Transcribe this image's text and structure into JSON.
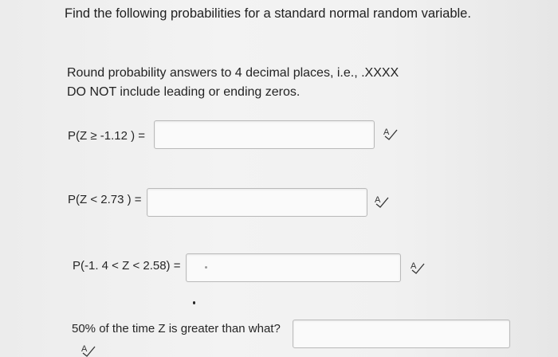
{
  "page": {
    "title": "Find the following probabilities for a standard normal random variable.",
    "instructions": [
      "Round probability answers to 4 decimal places, i.e., .XXXX",
      "DO NOT include leading or ending zeros."
    ]
  },
  "questions": [
    {
      "label": "P(Z ≥ -1.12 ) =",
      "value": ""
    },
    {
      "label": "P(Z < 2.73 ) =",
      "value": ""
    },
    {
      "label": "P(-1. 4 < Z < 2.58) =",
      "value": ""
    },
    {
      "label": "50% of the time Z is greater than what?",
      "value": ""
    }
  ],
  "icons": {
    "answer_check": "spell-check-icon"
  }
}
